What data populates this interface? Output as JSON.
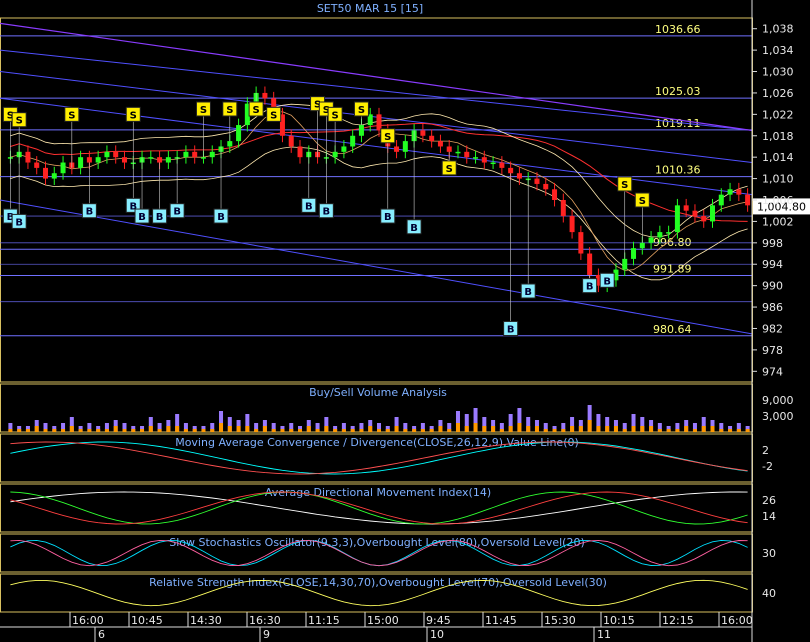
{
  "chart_data": {
    "type": "line",
    "title": "SET50 MAR 15   [15]",
    "last_price": "1,004.80",
    "price_axis": {
      "ticks": [
        "1,038",
        "1,034",
        "1,030",
        "1,026",
        "1,022",
        "1,018",
        "1,014",
        "1,010",
        "1,006",
        "1,002",
        "998",
        "994",
        "990",
        "986",
        "982",
        "978",
        "974"
      ],
      "ylim": [
        972,
        1040
      ]
    },
    "level_labels": [
      "1036.66",
      "1025.03",
      "1019.11",
      "1010.36",
      "996.80",
      "991.89",
      "980.64"
    ],
    "time_axis": {
      "labels": [
        "16:00",
        "10:45",
        "14:30",
        "16:30",
        "11:15",
        "15:00",
        "9:45",
        "11:45",
        "15:30",
        "10:15",
        "12:15",
        "16:00"
      ],
      "day_labels": [
        "6",
        "9",
        "10",
        "11"
      ]
    },
    "closes": [
      1014,
      1015,
      1013,
      1012,
      1010,
      1011,
      1013,
      1012,
      1014,
      1013,
      1014,
      1015,
      1014,
      1013,
      1013,
      1014,
      1014,
      1013,
      1014,
      1014,
      1015,
      1014,
      1014,
      1015,
      1016,
      1017,
      1020,
      1024,
      1026,
      1025,
      1022,
      1018,
      1016,
      1014,
      1015,
      1014,
      1014,
      1015,
      1016,
      1018,
      1020,
      1022,
      1019,
      1016,
      1015,
      1017,
      1019,
      1018,
      1017,
      1016,
      1015,
      1015,
      1014,
      1014,
      1013,
      1013,
      1012,
      1011,
      1010,
      1010,
      1009,
      1008,
      1006,
      1003,
      1000,
      996,
      992,
      990,
      991,
      993,
      995,
      997,
      998,
      999,
      1000,
      1000,
      1005,
      1004,
      1003,
      1002,
      1005,
      1007,
      1008,
      1007,
      1005
    ],
    "sell_signals": [
      [
        0,
        1022
      ],
      [
        1,
        1021
      ],
      [
        7,
        1022
      ],
      [
        14,
        1022
      ],
      [
        22,
        1023
      ],
      [
        25,
        1023
      ],
      [
        28,
        1023
      ],
      [
        30,
        1022
      ],
      [
        35,
        1024
      ],
      [
        36,
        1023
      ],
      [
        37,
        1022
      ],
      [
        40,
        1023
      ],
      [
        43,
        1018
      ],
      [
        50,
        1012
      ],
      [
        70,
        1009
      ],
      [
        72,
        1006
      ]
    ],
    "buy_signals": [
      [
        0,
        1003
      ],
      [
        1,
        1002
      ],
      [
        9,
        1004
      ],
      [
        14,
        1005
      ],
      [
        15,
        1003
      ],
      [
        17,
        1003
      ],
      [
        19,
        1004
      ],
      [
        24,
        1003
      ],
      [
        34,
        1005
      ],
      [
        36,
        1004
      ],
      [
        43,
        1003
      ],
      [
        46,
        1001
      ],
      [
        57,
        982
      ],
      [
        59,
        989
      ],
      [
        66,
        990
      ],
      [
        68,
        991
      ]
    ],
    "panels": [
      {
        "title": "Buy/Sell Volume Analysis",
        "ticks": [
          "9,000",
          "3,000"
        ],
        "volume_buy": [
          3,
          2,
          2,
          4,
          3,
          2,
          3,
          5,
          2,
          3,
          2,
          3,
          4,
          3,
          2,
          2,
          5,
          3,
          4,
          6,
          3,
          2,
          2,
          3,
          7,
          5,
          4,
          6,
          3,
          4,
          3,
          2,
          3,
          2,
          4,
          3,
          5,
          2,
          3,
          2,
          3,
          4,
          3,
          2,
          5,
          3,
          2,
          3,
          2,
          4,
          3,
          7,
          6,
          8,
          5,
          4,
          3,
          6,
          8,
          5,
          4,
          3,
          2,
          3,
          5,
          4,
          9,
          6,
          5,
          4,
          3,
          6,
          5,
          4,
          3,
          2,
          3,
          4,
          3,
          5,
          4,
          3,
          2,
          3,
          2
        ],
        "volume_sell": [
          1,
          1,
          1,
          2,
          1,
          1,
          1,
          2,
          1,
          1,
          1,
          1,
          2,
          1,
          1,
          1,
          2,
          1,
          2,
          2,
          1,
          1,
          1,
          1,
          3,
          2,
          2,
          2,
          1,
          2,
          1,
          1,
          1,
          1,
          2,
          1,
          2,
          1,
          1,
          1,
          1,
          2,
          1,
          1,
          2,
          1,
          1,
          1,
          1,
          2,
          1,
          3,
          2,
          3,
          2,
          2,
          1,
          2,
          3,
          2,
          2,
          1,
          1,
          1,
          2,
          2,
          4,
          2,
          2,
          2,
          1,
          2,
          2,
          2,
          1,
          1,
          1,
          2,
          1,
          2,
          2,
          1,
          1,
          1,
          1
        ]
      },
      {
        "title": "Moving Average Convergence / Divergence(CLOSE,26,12,9),Value Line(0)",
        "ticks": [
          "2",
          "-2"
        ]
      },
      {
        "title": "Average Directional Movement Index(14)",
        "ticks": [
          "26",
          "14"
        ]
      },
      {
        "title": "Slow Stochastics Oscillator(9,3,3),Overbought Level(80),Oversold Level(20)",
        "ticks": [
          "30"
        ]
      },
      {
        "title": "Relative Strength Index(CLOSE,14,30,70),Overbought Level(70),Oversold Level(30)",
        "ticks": [
          "40"
        ]
      }
    ],
    "colors": {
      "up": "#22ff22",
      "down": "#ff2222",
      "ma_red": "#ff3030",
      "ma_violet": "#8a3cff",
      "ma_blue": "#5050ff",
      "band": "#ffe9b0",
      "level_line": "#7070ff",
      "panel_border": "#d8c060"
    }
  }
}
